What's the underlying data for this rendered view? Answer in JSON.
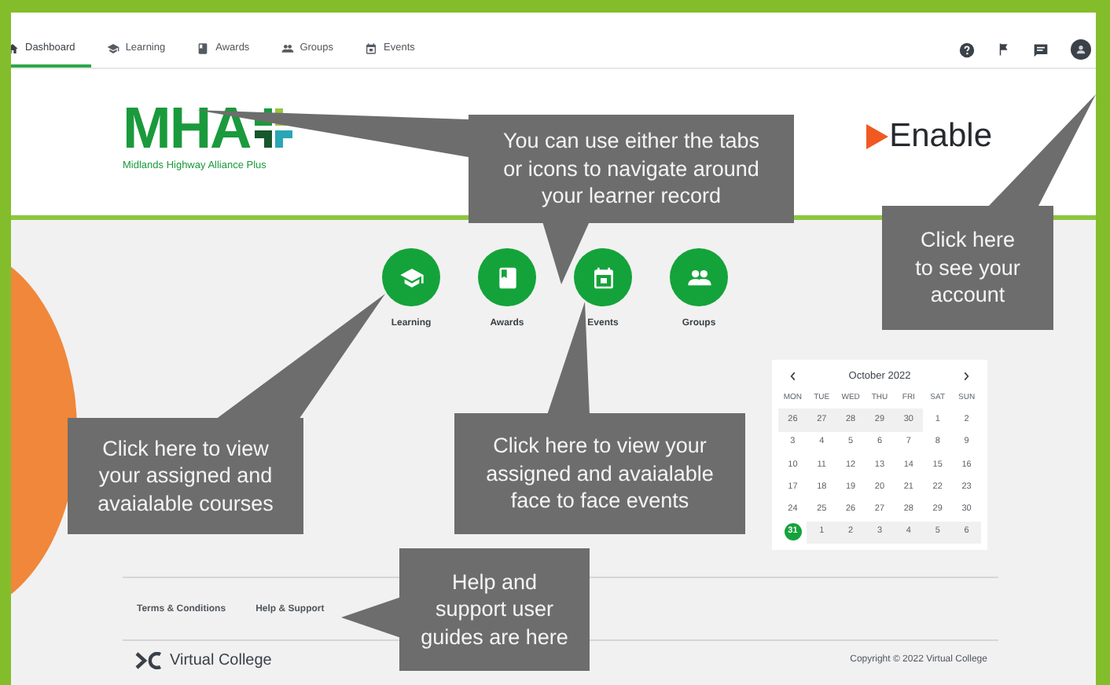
{
  "nav": {
    "tabs": [
      {
        "label": "Dashboard",
        "selected": true
      },
      {
        "label": "Learning",
        "selected": false
      },
      {
        "label": "Awards",
        "selected": false
      },
      {
        "label": "Groups",
        "selected": false
      },
      {
        "label": "Events",
        "selected": false
      }
    ]
  },
  "header": {
    "mha_logo": {
      "wordmark": "MHA",
      "tagline": "Midlands Highway Alliance Plus"
    },
    "enable_logo": {
      "wordmark": "Enable"
    }
  },
  "shortcuts": [
    {
      "label": "Learning"
    },
    {
      "label": "Awards"
    },
    {
      "label": "Events"
    },
    {
      "label": "Groups"
    }
  ],
  "calendar": {
    "month": "October 2022",
    "weekdays": [
      "MON",
      "TUE",
      "WED",
      "THU",
      "FRI",
      "SAT",
      "SUN"
    ],
    "weeks": [
      [
        {
          "day": "26",
          "outside": true,
          "selected": false
        },
        {
          "day": "27",
          "outside": true,
          "selected": false
        },
        {
          "day": "28",
          "outside": true,
          "selected": false
        },
        {
          "day": "29",
          "outside": true,
          "selected": false
        },
        {
          "day": "30",
          "outside": true,
          "selected": false
        },
        {
          "day": "1",
          "outside": false,
          "selected": false
        },
        {
          "day": "2",
          "outside": false,
          "selected": false
        }
      ],
      [
        {
          "day": "3",
          "outside": false,
          "selected": false
        },
        {
          "day": "4",
          "outside": false,
          "selected": false
        },
        {
          "day": "5",
          "outside": false,
          "selected": false
        },
        {
          "day": "6",
          "outside": false,
          "selected": false
        },
        {
          "day": "7",
          "outside": false,
          "selected": false
        },
        {
          "day": "8",
          "outside": false,
          "selected": false
        },
        {
          "day": "9",
          "outside": false,
          "selected": false
        }
      ],
      [
        {
          "day": "10",
          "outside": false,
          "selected": false
        },
        {
          "day": "11",
          "outside": false,
          "selected": false
        },
        {
          "day": "12",
          "outside": false,
          "selected": false
        },
        {
          "day": "13",
          "outside": false,
          "selected": false
        },
        {
          "day": "14",
          "outside": false,
          "selected": false
        },
        {
          "day": "15",
          "outside": false,
          "selected": false
        },
        {
          "day": "16",
          "outside": false,
          "selected": false
        }
      ],
      [
        {
          "day": "17",
          "outside": false,
          "selected": false
        },
        {
          "day": "18",
          "outside": false,
          "selected": false
        },
        {
          "day": "19",
          "outside": false,
          "selected": false
        },
        {
          "day": "20",
          "outside": false,
          "selected": false
        },
        {
          "day": "21",
          "outside": false,
          "selected": false
        },
        {
          "day": "22",
          "outside": false,
          "selected": false
        },
        {
          "day": "23",
          "outside": false,
          "selected": false
        }
      ],
      [
        {
          "day": "24",
          "outside": false,
          "selected": false
        },
        {
          "day": "25",
          "outside": false,
          "selected": false
        },
        {
          "day": "26",
          "outside": false,
          "selected": false
        },
        {
          "day": "27",
          "outside": false,
          "selected": false
        },
        {
          "day": "28",
          "outside": false,
          "selected": false
        },
        {
          "day": "29",
          "outside": false,
          "selected": false
        },
        {
          "day": "30",
          "outside": false,
          "selected": false
        }
      ],
      [
        {
          "day": "31",
          "outside": false,
          "selected": true
        },
        {
          "day": "1",
          "outside": true,
          "selected": false
        },
        {
          "day": "2",
          "outside": true,
          "selected": false
        },
        {
          "day": "3",
          "outside": true,
          "selected": false
        },
        {
          "day": "4",
          "outside": true,
          "selected": false
        },
        {
          "day": "5",
          "outside": true,
          "selected": false
        },
        {
          "day": "6",
          "outside": true,
          "selected": false
        }
      ]
    ]
  },
  "footer": {
    "links": [
      "Terms & Conditions",
      "Help & Support"
    ],
    "brand": "Virtual College",
    "copyright": "Copyright © 2022 Virtual College"
  },
  "callouts": [
    {
      "text": "You can use either the tabs\nor icons to navigate around\nyour learner record"
    },
    {
      "text": "Click here\nto see your\naccount"
    },
    {
      "text": "Click here to view\nyour assigned and\navaialable courses"
    },
    {
      "text": "Click here to view your\nassigned and avaialable\nface to face events"
    },
    {
      "text": "Help and\nsupport user\nguides are here"
    }
  ]
}
